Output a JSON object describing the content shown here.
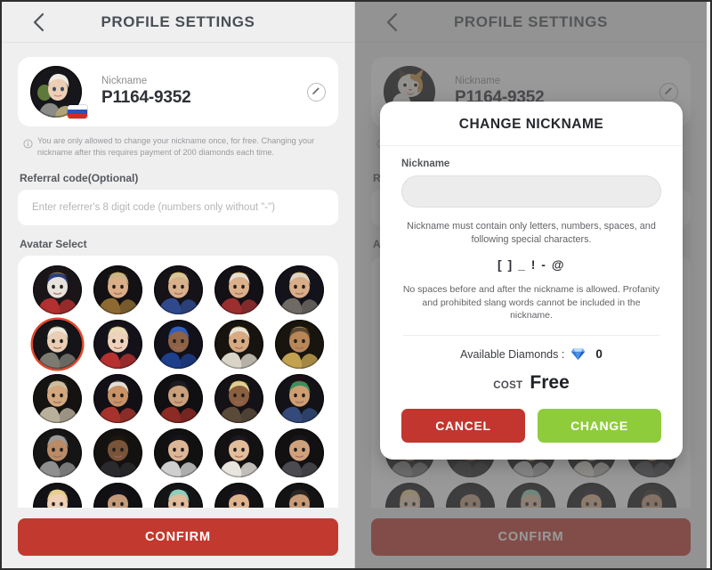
{
  "theme": {
    "page_bg": "#efefef",
    "card_bg": "#ffffff",
    "accent_red": "#c2392f",
    "accent_green": "#8fcc3c",
    "selected_ring": "#e2462c",
    "overlay": "rgba(90,90,90,0.62)",
    "title_color": "#4a4f56"
  },
  "header": {
    "title": "PROFILE SETTINGS",
    "back_icon": "chevron-left-icon"
  },
  "profile": {
    "nickname_label": "Nickname",
    "nickname_value": "P1164-9352",
    "edit_icon": "pencil-icon",
    "flag": "russia-flag",
    "avatar_left": "warrior-maiden-avatar",
    "avatar_right": "cat-avatar"
  },
  "note": {
    "icon": "info-circle-icon",
    "text": "You are only allowed to change your nickname once, for free. Changing your nickname after this requires payment of 200 diamonds each time."
  },
  "referral": {
    "label": "Referral code(Optional)",
    "placeholder": "Enter referrer's 8 digit code (numbers only without \"-\")",
    "value": ""
  },
  "avatar_select": {
    "label": "Avatar Select",
    "rows": 5,
    "columns": 5,
    "selected_index": 5,
    "items": [
      {
        "name": "jester-king-avatar",
        "bg": "#1a1518",
        "skin": "#e8e2dd",
        "hair": "#2b3f80",
        "cloth": "#b23030",
        "hat": "#c9a227"
      },
      {
        "name": "bearded-king-avatar",
        "bg": "#141114",
        "skin": "#dcae86",
        "hair": "#c8b48a",
        "cloth": "#8c6a32",
        "hat": "#d4af37"
      },
      {
        "name": "crowned-knight-avatar",
        "bg": "#151218",
        "skin": "#d9b08c",
        "hair": "#d8c79a",
        "cloth": "#2f4a8c",
        "hat": "#d9b64a"
      },
      {
        "name": "emperor-avatar",
        "bg": "#131016",
        "skin": "#dcb08a",
        "hair": "#e6e0d4",
        "cloth": "#9b2f2f",
        "hat": "#d6b13c"
      },
      {
        "name": "sword-king-avatar",
        "bg": "#14121a",
        "skin": "#d8ad87",
        "hair": "#ddd6c8",
        "cloth": "#6f6a63",
        "hat": "#d3ae3f"
      },
      {
        "name": "white-hair-warrior-avatar",
        "bg": "#151519",
        "skin": "#e9cdb4",
        "hair": "#efe8de",
        "cloth": "#7d7a72",
        "hat": "#9aa861"
      },
      {
        "name": "golden-queen-avatar",
        "bg": "#14111a",
        "skin": "#f0d2bb",
        "hair": "#e8dcb8",
        "cloth": "#b5302f",
        "hat": "#d7b340"
      },
      {
        "name": "blue-hood-woman-avatar",
        "bg": "#121018",
        "skin": "#8d6246",
        "hair": "#2f5fc0",
        "cloth": "#1d3f8c",
        "hat": "#2f5fc0"
      },
      {
        "name": "laurel-thinker-avatar",
        "bg": "#17130f",
        "skin": "#d7aa82",
        "hair": "#e9e4d8",
        "cloth": "#d8d4c8",
        "hat": "#c8a83c"
      },
      {
        "name": "bronze-helm-avatar",
        "bg": "#18140e",
        "skin": "#b98658",
        "hair": "#5c4a33",
        "cloth": "#c2a14f",
        "hat": "#c9a040"
      },
      {
        "name": "praying-elder-avatar",
        "bg": "#141312",
        "skin": "#d3a87f",
        "hair": "#cdbf9e",
        "cloth": "#b9b09b",
        "hat": "#c0a869"
      },
      {
        "name": "pirate-captain-avatar",
        "bg": "#121016",
        "skin": "#c89266",
        "hair": "#e4dfd6",
        "cloth": "#a5332c",
        "hat": "#2a2a30"
      },
      {
        "name": "dark-ninja-avatar",
        "bg": "#100f12",
        "skin": "#caa07c",
        "hair": "#1d1c22",
        "cloth": "#8c2a24",
        "hat": "#22212a"
      },
      {
        "name": "tribal-woman-avatar",
        "bg": "#151217",
        "skin": "#8a5f40",
        "hair": "#e1cf92",
        "cloth": "#5a4a3a",
        "hat": "#cfae48"
      },
      {
        "name": "parrot-sailor-avatar",
        "bg": "#131217",
        "skin": "#cf9d72",
        "hair": "#3f8f5c",
        "cloth": "#334a7a",
        "hat": "#b52f2f"
      },
      {
        "name": "hooded-sunglasses-avatar",
        "bg": "#151515",
        "skin": "#b98b66",
        "hair": "#9a9a9a",
        "cloth": "#8f8f8f",
        "hat": "#9a9a9a"
      },
      {
        "name": "suited-man-avatar",
        "bg": "#141210",
        "skin": "#7a5438",
        "hair": "#19170f",
        "cloth": "#2a2a2e",
        "hat": "#19170f"
      },
      {
        "name": "chubby-boy-avatar",
        "bg": "#121112",
        "skin": "#ddb795",
        "hair": "#15141a",
        "cloth": "#cfcfcf",
        "hat": "#15141a"
      },
      {
        "name": "smiling-youth-avatar",
        "bg": "#131112",
        "skin": "#e3bd9a",
        "hair": "#1a1820",
        "cloth": "#e8e4de",
        "hat": "#1a1820"
      },
      {
        "name": "mustache-man-avatar",
        "bg": "#121010",
        "skin": "#cfa27c",
        "hair": "#17161c",
        "cloth": "#4a4a50",
        "hat": "#17161c"
      },
      {
        "name": "blonde-woman-avatar",
        "bg": "#121115",
        "skin": "#efd0b6",
        "hair": "#e8cf8d",
        "cloth": "#b84a58",
        "hat": "#e8cf8d"
      },
      {
        "name": "angry-longhair-avatar",
        "bg": "#100f12",
        "skin": "#c59a79",
        "hair": "#14131a",
        "cloth": "#7a2a2a",
        "hat": "#14131a"
      },
      {
        "name": "mint-hood-avatar",
        "bg": "#131416",
        "skin": "#e0bb9c",
        "hair": "#8fd0bc",
        "cloth": "#8fd0bc",
        "hat": "#8fd0bc"
      },
      {
        "name": "sunglasses-boy-avatar",
        "bg": "#121113",
        "skin": "#e0b28c",
        "hair": "#191820",
        "cloth": "#cf5a3a",
        "hat": "#191820"
      },
      {
        "name": "old-mustache-avatar",
        "bg": "#141313",
        "skin": "#c79a76",
        "hair": "#2a2622",
        "cloth": "#5a544c",
        "hat": "#2a2622"
      }
    ]
  },
  "confirm": {
    "label": "CONFIRM"
  },
  "modal": {
    "title": "CHANGE NICKNAME",
    "field_label": "Nickname",
    "input_value": "",
    "input_placeholder": "",
    "rule_text": "Nickname must contain only letters, numbers, spaces, and following special characters.",
    "special_chars": "[ ] _ ! - @",
    "rule_text2": "No spaces before and after the nickname is allowed. Profanity and prohibited slang words cannot be included in the nickname.",
    "diamonds_label": "Available Diamonds :",
    "diamonds_icon": "diamond-gem-icon",
    "diamonds_value": "0",
    "cost_label": "COST",
    "cost_value": "Free",
    "cancel_label": "CANCEL",
    "change_label": "CHANGE"
  }
}
